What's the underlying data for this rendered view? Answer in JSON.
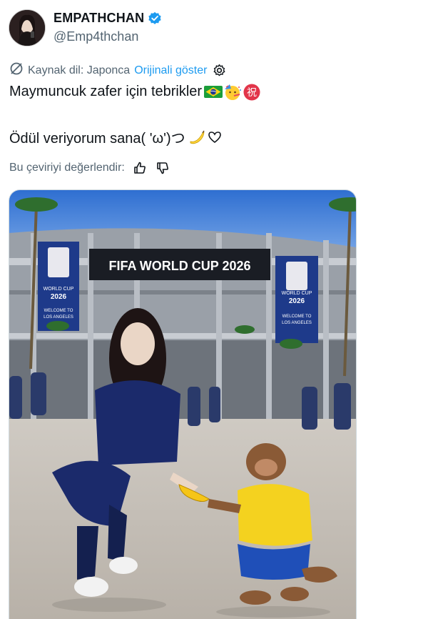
{
  "author": {
    "display_name": "EMPATHCHAN",
    "handle": "@Emp4thchan",
    "verified": true
  },
  "translation": {
    "source_label": "Kaynak dil: Japonca",
    "show_original": "Orijinali göster",
    "rate_label": "Bu çeviriyi değerlendir:"
  },
  "tweet": {
    "line1": "Maymuncuk zafer için tebrikler",
    "line2": "Ödül veriyorum sana( 'ω')つ",
    "line1_emojis": [
      "brazil-flag",
      "party-face",
      "celebration-kanji"
    ],
    "line2_emojis": [
      "banana",
      "heart-outline"
    ]
  },
  "image": {
    "stadium_banner": "FIFA WORLD CUP 2026",
    "side_banner_top": "WORLD CUP",
    "side_banner_year": "2026",
    "side_banner_bottom1": "WELCOME TO",
    "side_banner_bottom2": "LOS ANGELES",
    "kanji": "祝"
  },
  "colors": {
    "link": "#1d9bf0",
    "secondary_text": "#536471",
    "primary_text": "#0f1419",
    "verified": "#1d9bf0"
  }
}
